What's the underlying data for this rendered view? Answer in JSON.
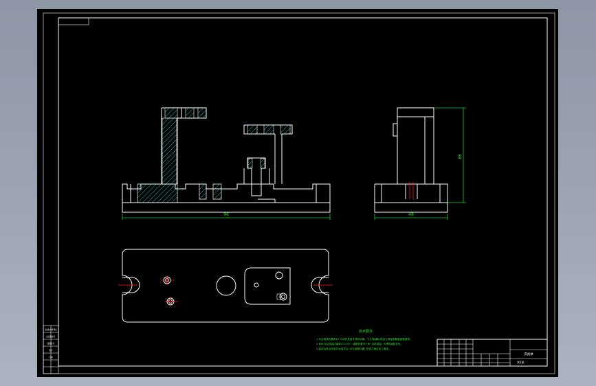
{
  "drawing": {
    "dimensions": {
      "front_width": "96",
      "side_width": "48",
      "side_height": "86"
    },
    "notes": {
      "heading": "技术要求",
      "lines": [
        "1.未注明铸件圆角R2-3,铸件表面不得有砂眼、气孔等缺陷,精加工表面粗糙度按图要求。",
        "2.零件去毛刺锐边倒角0.5×45°, 装配前清洗干净, 涂防锈油, 不得有磕碰划伤。",
        "3.装配后各活动部件运动灵活, 定位准确可靠, 夹紧力满足加工要求。"
      ]
    },
    "title_block": {
      "drawing_name": "夹具体",
      "sheet": "共1张"
    },
    "left_strip": {
      "cells": [
        "借(通)用件登记",
        "旧底图总号",
        "底图总号",
        "签字",
        "日期"
      ]
    },
    "colors": {
      "paper": "#000000",
      "line": "#ffffff",
      "dimension": "#1fd01f",
      "hatch": "#1fd0d0",
      "centerline": "#ff2020"
    }
  }
}
